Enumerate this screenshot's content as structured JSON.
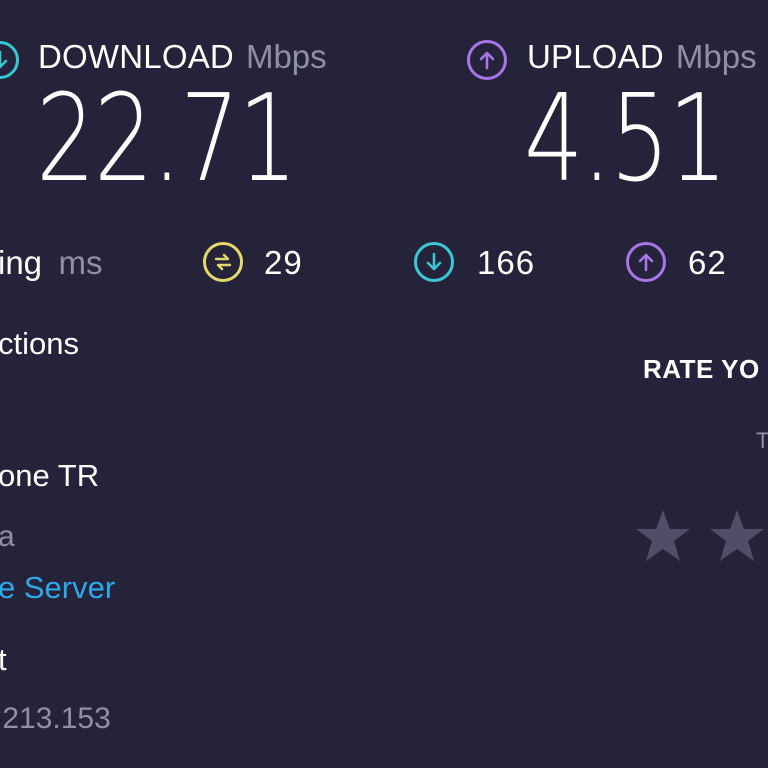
{
  "download": {
    "label": "DOWNLOAD",
    "unit": "Mbps",
    "value": "22.71",
    "icon": "arrow-down-circle-icon",
    "color": "#37c8d4"
  },
  "upload": {
    "label": "UPLOAD",
    "unit": "Mbps",
    "value": "4.51",
    "icon": "arrow-up-circle-icon",
    "color": "#a975e8"
  },
  "ping": {
    "label": "ing",
    "unit": "ms",
    "idle": {
      "value": "29",
      "icon": "ping-idle-icon",
      "color": "#e3d96a"
    },
    "down": {
      "value": "166",
      "icon": "arrow-down-circle-icon",
      "color": "#37c8d4"
    },
    "up": {
      "value": "62",
      "icon": "arrow-up-circle-icon",
      "color": "#a975e8"
    }
  },
  "connections": {
    "title": "ctions",
    "provider": "one TR",
    "location": "a",
    "change_server": "e Server",
    "host_title": "t",
    "ip": ".213.153"
  },
  "rate": {
    "title": "RATE YO",
    "hint": "T",
    "star_count": 2
  }
}
